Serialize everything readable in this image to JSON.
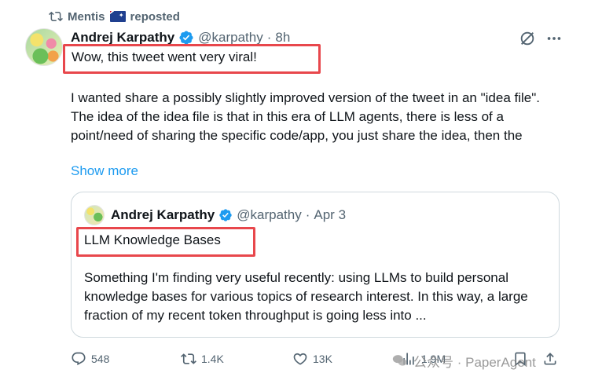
{
  "repost": {
    "user": "Mentis",
    "flag_label": "🇦🇺",
    "label": "reposted"
  },
  "tweet": {
    "author": "Andrej Karpathy",
    "handle": "@karpathy",
    "separator": "·",
    "time": "8h",
    "highlight_text": "Wow, this tweet went very viral!",
    "body": "I wanted share a possibly slightly improved version of the tweet in an \"idea file\". The idea of the idea file is that in this era of LLM agents, there is less of a point/need of sharing the specific code/app, you just share the idea, then the",
    "show_more": "Show more"
  },
  "quote": {
    "author": "Andrej Karpathy",
    "handle": "@karpathy",
    "separator": "·",
    "date": "Apr 3",
    "highlight_text": "LLM Knowledge Bases",
    "body": "Something I'm finding very useful recently: using LLMs to build personal knowledge bases for various topics of research interest. In this way, a large fraction of my recent token throughput is going less into ..."
  },
  "actions": {
    "replies": "548",
    "reposts": "1.4K",
    "likes": "13K",
    "views": "1.9M"
  },
  "watermark": {
    "text": "公众号 · PaperAgent"
  },
  "colors": {
    "accent": "#1d9bf0",
    "secondary_text": "#536471",
    "highlight_border": "#e8474c",
    "border": "#cfd9de"
  },
  "icons": [
    "repost-icon",
    "verified-badge-icon",
    "grok-icon",
    "more-icon",
    "reply-icon",
    "like-icon",
    "views-icon",
    "bookmark-icon",
    "share-icon",
    "wechat-icon"
  ]
}
